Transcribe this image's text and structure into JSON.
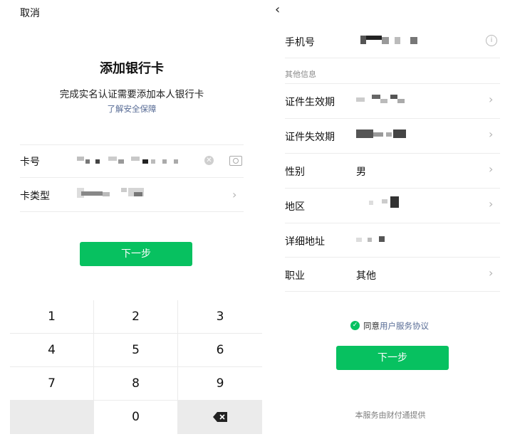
{
  "left": {
    "cancel_label": "取消",
    "title": "添加银行卡",
    "subtitle": "完成实名认证需要添加本人银行卡",
    "learn_link": "了解安全保障",
    "fields": {
      "card_number_label": "卡号",
      "card_type_label": "卡类型"
    },
    "icons": [
      "clear-icon",
      "camera-icon",
      "chevron-right-icon"
    ],
    "next_label": "下一步",
    "keypad": [
      "1",
      "2",
      "3",
      "4",
      "5",
      "6",
      "7",
      "8",
      "9",
      "",
      "0",
      "⌫"
    ]
  },
  "right": {
    "back_icon": "chevron-left-icon",
    "phone_label": "手机号",
    "section_label": "其他信息",
    "rows": [
      {
        "label": "证件生效期",
        "value": "",
        "chevron": true
      },
      {
        "label": "证件失效期",
        "value": "",
        "chevron": true
      },
      {
        "label": "性别",
        "value": "男",
        "chevron": true
      },
      {
        "label": "地区",
        "value": "",
        "chevron": true
      },
      {
        "label": "详细地址",
        "value": "",
        "chevron": false
      },
      {
        "label": "职业",
        "value": "其他",
        "chevron": true
      }
    ],
    "agree_prefix": "同意",
    "agree_link": "用户服务协议",
    "next_label": "下一步",
    "footer": "本服务由财付通提供",
    "accent_color": "#07c160",
    "link_color": "#576b95"
  }
}
